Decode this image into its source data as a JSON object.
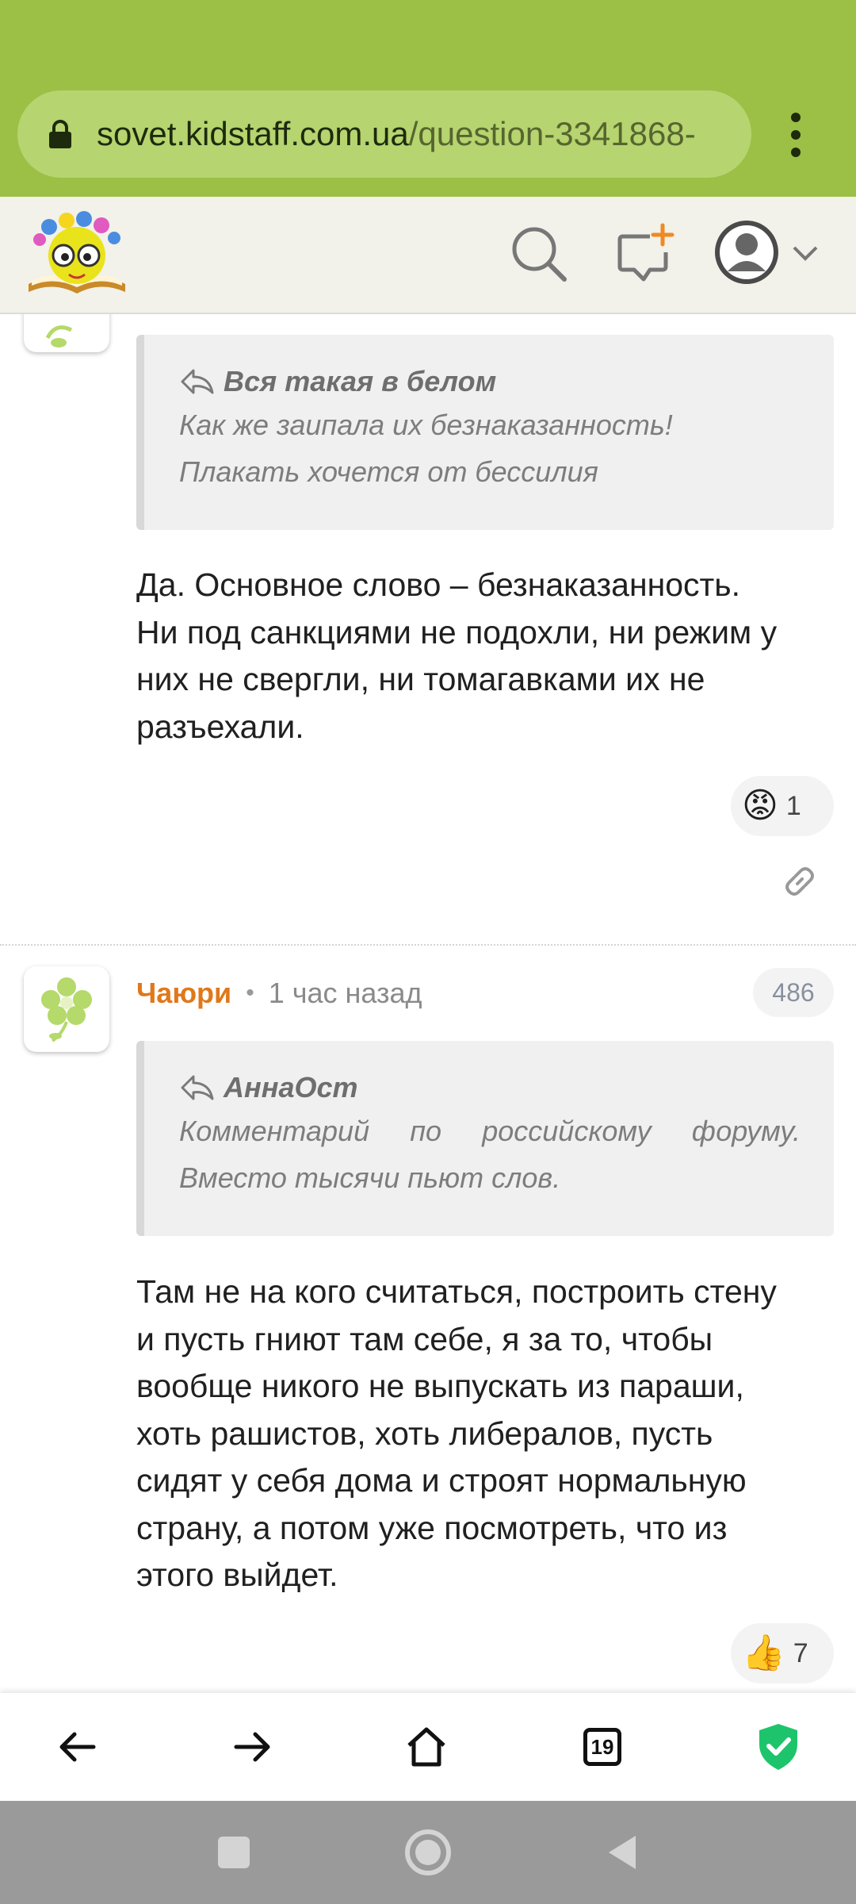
{
  "browser": {
    "url_host": "sovet.kidstaff.com.ua",
    "url_path": "/question-3341868-",
    "menu_icon": "kebab-menu-icon",
    "accent_color": "#9bc045"
  },
  "site_header": {
    "logo_icon": "kidstaff-logo-icon",
    "search_icon": "search-icon",
    "new_post_icon": "new-message-icon",
    "avatar_icon": "user-avatar-icon"
  },
  "comments": [
    {
      "quote_author": "Вся такая в белом",
      "quote_lines": [
        "Как же заипала их безнаказанность!",
        "Плакать хочется от бессилия"
      ],
      "body_lines": [
        "Да. Основное слово – безнаказанность.",
        "Ни под санкциями не подохли, ни режим у",
        "них не свергли, ни томагавками их не",
        "разъехали."
      ],
      "reaction_emoji": "😡",
      "reaction_count": "1",
      "link_icon": "link-icon"
    },
    {
      "author": "Чаюри",
      "time": "1 час назад",
      "rating": "486",
      "quote_author": "АннаОст",
      "quote_line1_words": [
        "Комментарий",
        "по",
        "российскому",
        "форуму."
      ],
      "quote_line2": "Вместо тысячи пьют слов.",
      "body_lines": [
        "Там не на кого считаться, построить стену",
        "и пусть гниют там себе, я за то, чтобы",
        "вообще никого не выпускать из параши,",
        "хоть рашистов, хоть либералов, пусть",
        "сидят у себя дома и строят нормальную",
        "страну, а потом уже посмотреть, что из",
        "этого выйдет."
      ],
      "reaction_emoji": "👍",
      "reaction_count": "7"
    }
  ],
  "toolbar": {
    "back_icon": "back-arrow-icon",
    "forward_icon": "forward-arrow-icon",
    "home_icon": "home-icon",
    "tab_count": "19",
    "shield_icon": "shield-check-icon"
  },
  "system_nav": {
    "recents_icon": "recents-square-icon",
    "home_icon": "home-circle-icon",
    "back_icon": "back-triangle-icon"
  }
}
